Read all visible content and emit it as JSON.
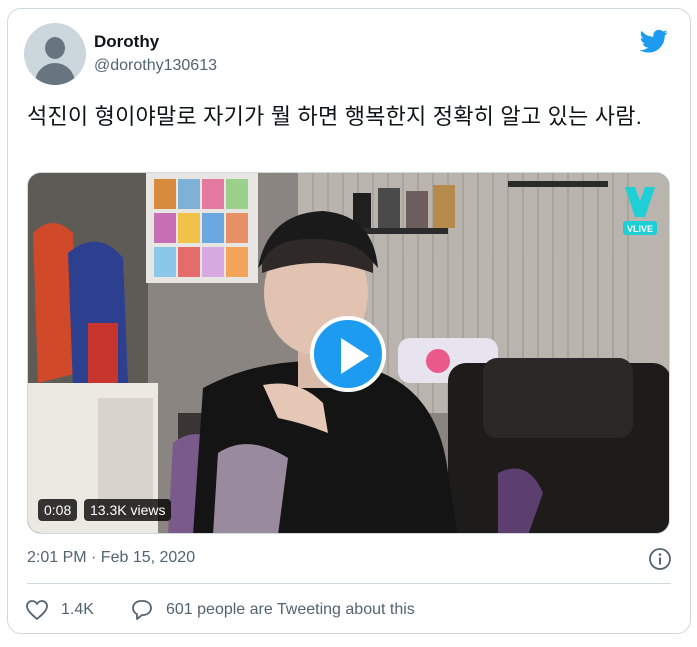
{
  "user": {
    "display_name": "Dorothy",
    "handle": "@dorothy130613"
  },
  "tweet": {
    "text": "석진이 형이야말로 자기가 뭘 하면 행복한지 정확히 알고 있는 사람.",
    "timestamp": "2:01 PM · Feb 15, 2020"
  },
  "media": {
    "duration": "0:08",
    "views": "13.3K views",
    "watermark": "VLIVE"
  },
  "actions": {
    "likes": "1.4K",
    "tweeting": "601 people are Tweeting about this"
  },
  "colors": {
    "twitter_blue": "#1d9bf0",
    "text_secondary": "#536471",
    "border": "#cfd9de"
  },
  "icons": [
    "twitter-bird-icon",
    "play-icon",
    "info-icon",
    "heart-icon",
    "speech-bubble-icon"
  ]
}
